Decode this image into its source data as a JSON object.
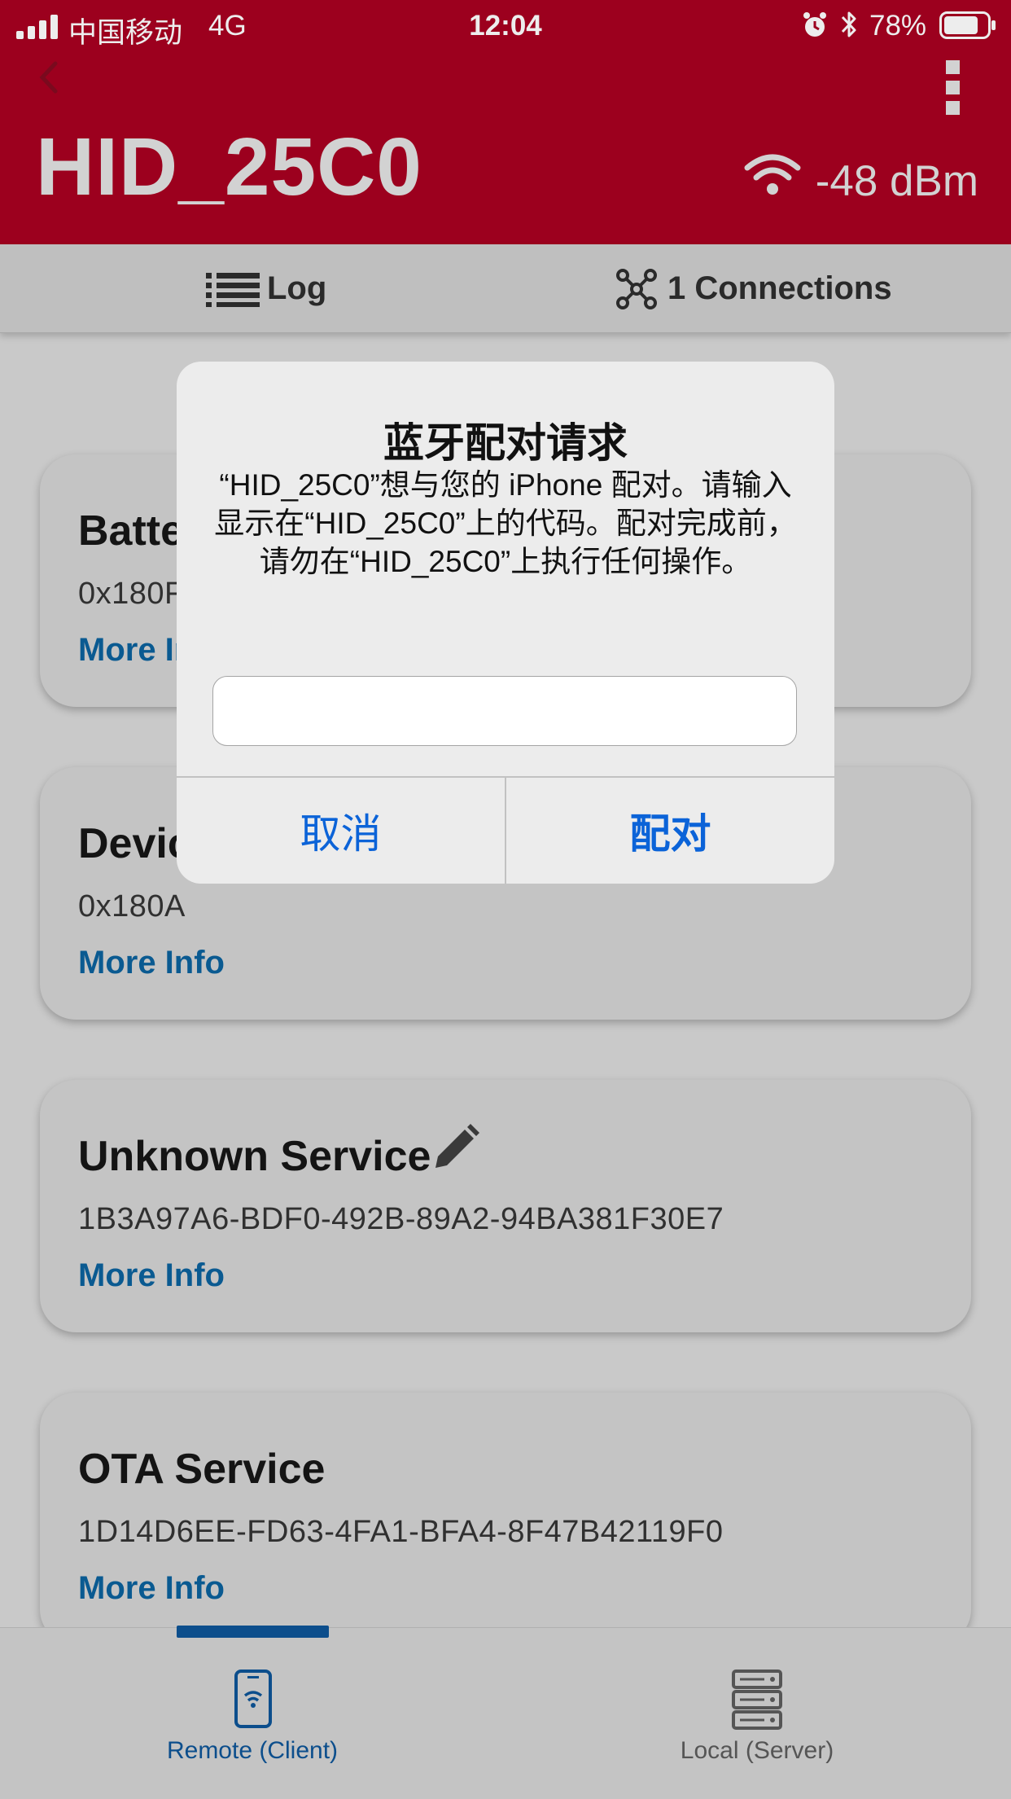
{
  "status_bar": {
    "carrier": "中国移动",
    "network": "4G",
    "time": "12:04",
    "battery": "78%",
    "battery_level": 0.78
  },
  "header": {
    "title": "HID_25C0",
    "rssi": "-48 dBm",
    "back_icon": "chevron-left-icon",
    "menu_icon": "more-vertical-icon"
  },
  "tabs": {
    "log": "Log",
    "connections": "1 Connections"
  },
  "services": [
    {
      "name": "Batte",
      "uuid": "0x180F",
      "more": "More Info"
    },
    {
      "name": "Devic",
      "uuid": "0x180A",
      "more": "More Info"
    },
    {
      "name": "Unknown Service",
      "uuid": "1B3A97A6-BDF0-492B-89A2-94BA381F30E7",
      "more": "More Info"
    },
    {
      "name": "OTA Service",
      "uuid": "1D14D6EE-FD63-4FA1-BFA4-8F47B42119F0",
      "more": "More Info"
    }
  ],
  "bottom_nav": {
    "remote": "Remote (Client)",
    "local": "Local (Server)"
  },
  "dialog": {
    "title": "蓝牙配对请求",
    "message": "“HID_25C0”想与您的 iPhone 配对。请输入显示在“HID_25C0”上的代码。配对完成前，请勿在“HID_25C0”上执行任何操作。",
    "input_value": "",
    "cancel": "取消",
    "confirm": "配对"
  },
  "colors": {
    "header": "#9c001e",
    "link": "#0a5a91",
    "ios_blue": "#0b63d8",
    "nav_active": "#0c4e8c"
  }
}
